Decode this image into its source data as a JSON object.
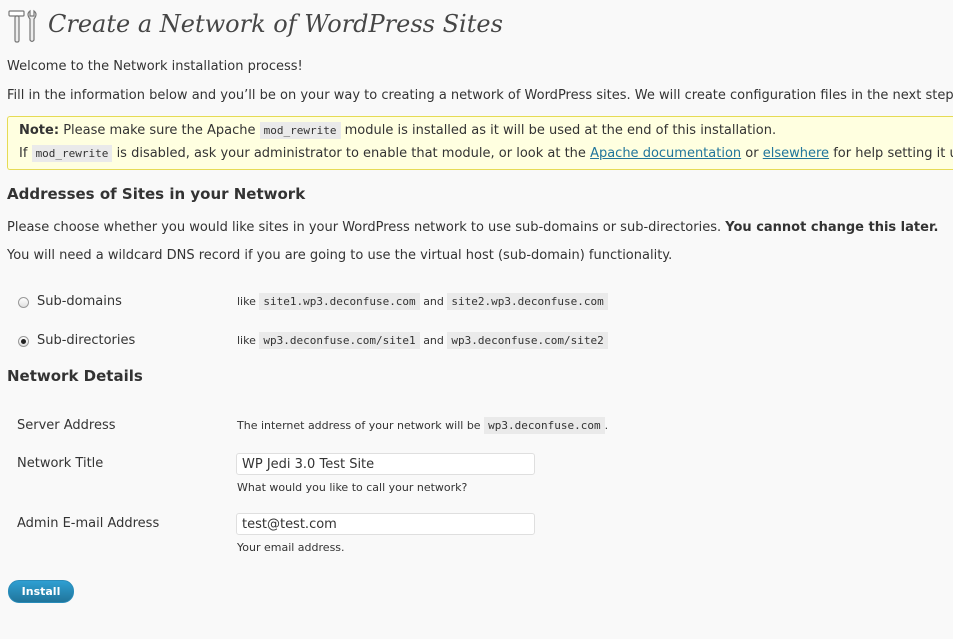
{
  "header": {
    "title": "Create a Network of WordPress Sites",
    "icon": "tools-icon"
  },
  "intro": {
    "welcome": "Welcome to the Network installation process!",
    "fill_in": "Fill in the information below and you’ll be on your way to creating a network of WordPress sites. We will create configuration files in the next step."
  },
  "notice": {
    "note_label": "Note:",
    "line1_a": "Please make sure the Apache",
    "line1_code": "mod_rewrite",
    "line1_b": "module is installed as it will be used at the end of this installation.",
    "line2_a": "If",
    "line2_code": "mod_rewrite",
    "line2_b": "is disabled, ask your administrator to enable that module, or look at the",
    "link1": "Apache documentation",
    "line2_or": "or",
    "link2": "elsewhere",
    "line2_c": "for help setting it up.",
    "background": "#ffffe0",
    "border": "#e6db55"
  },
  "addresses": {
    "heading": "Addresses of Sites in your Network",
    "choose_text": "Please choose whether you would like sites in your WordPress network to use sub-domains or sub-directories.",
    "choose_bold": "You cannot change this later.",
    "wildcard_text": "You will need a wildcard DNS record if you are going to use the virtual host (sub-domain) functionality.",
    "options": [
      {
        "label": "Sub-domains",
        "checked": false,
        "like": "like",
        "ex1": "site1.wp3.deconfuse.com",
        "and": "and",
        "ex2": "site2.wp3.deconfuse.com"
      },
      {
        "label": "Sub-directories",
        "checked": true,
        "like": "like",
        "ex1": "wp3.deconfuse.com/site1",
        "and": "and",
        "ex2": "wp3.deconfuse.com/site2"
      }
    ]
  },
  "details": {
    "heading": "Network Details",
    "server_label": "Server Address",
    "server_text": "The internet address of your network will be",
    "server_code": "wp3.deconfuse.com",
    "server_period": ".",
    "title_label": "Network Title",
    "title_value": "WP Jedi 3.0 Test Site",
    "title_help": "What would you like to call your network?",
    "email_label": "Admin E-mail Address",
    "email_value": "test@test.com",
    "email_help": "Your email address."
  },
  "install_button": "Install",
  "colors": {
    "link": "#21759b",
    "button": "#21759b"
  }
}
